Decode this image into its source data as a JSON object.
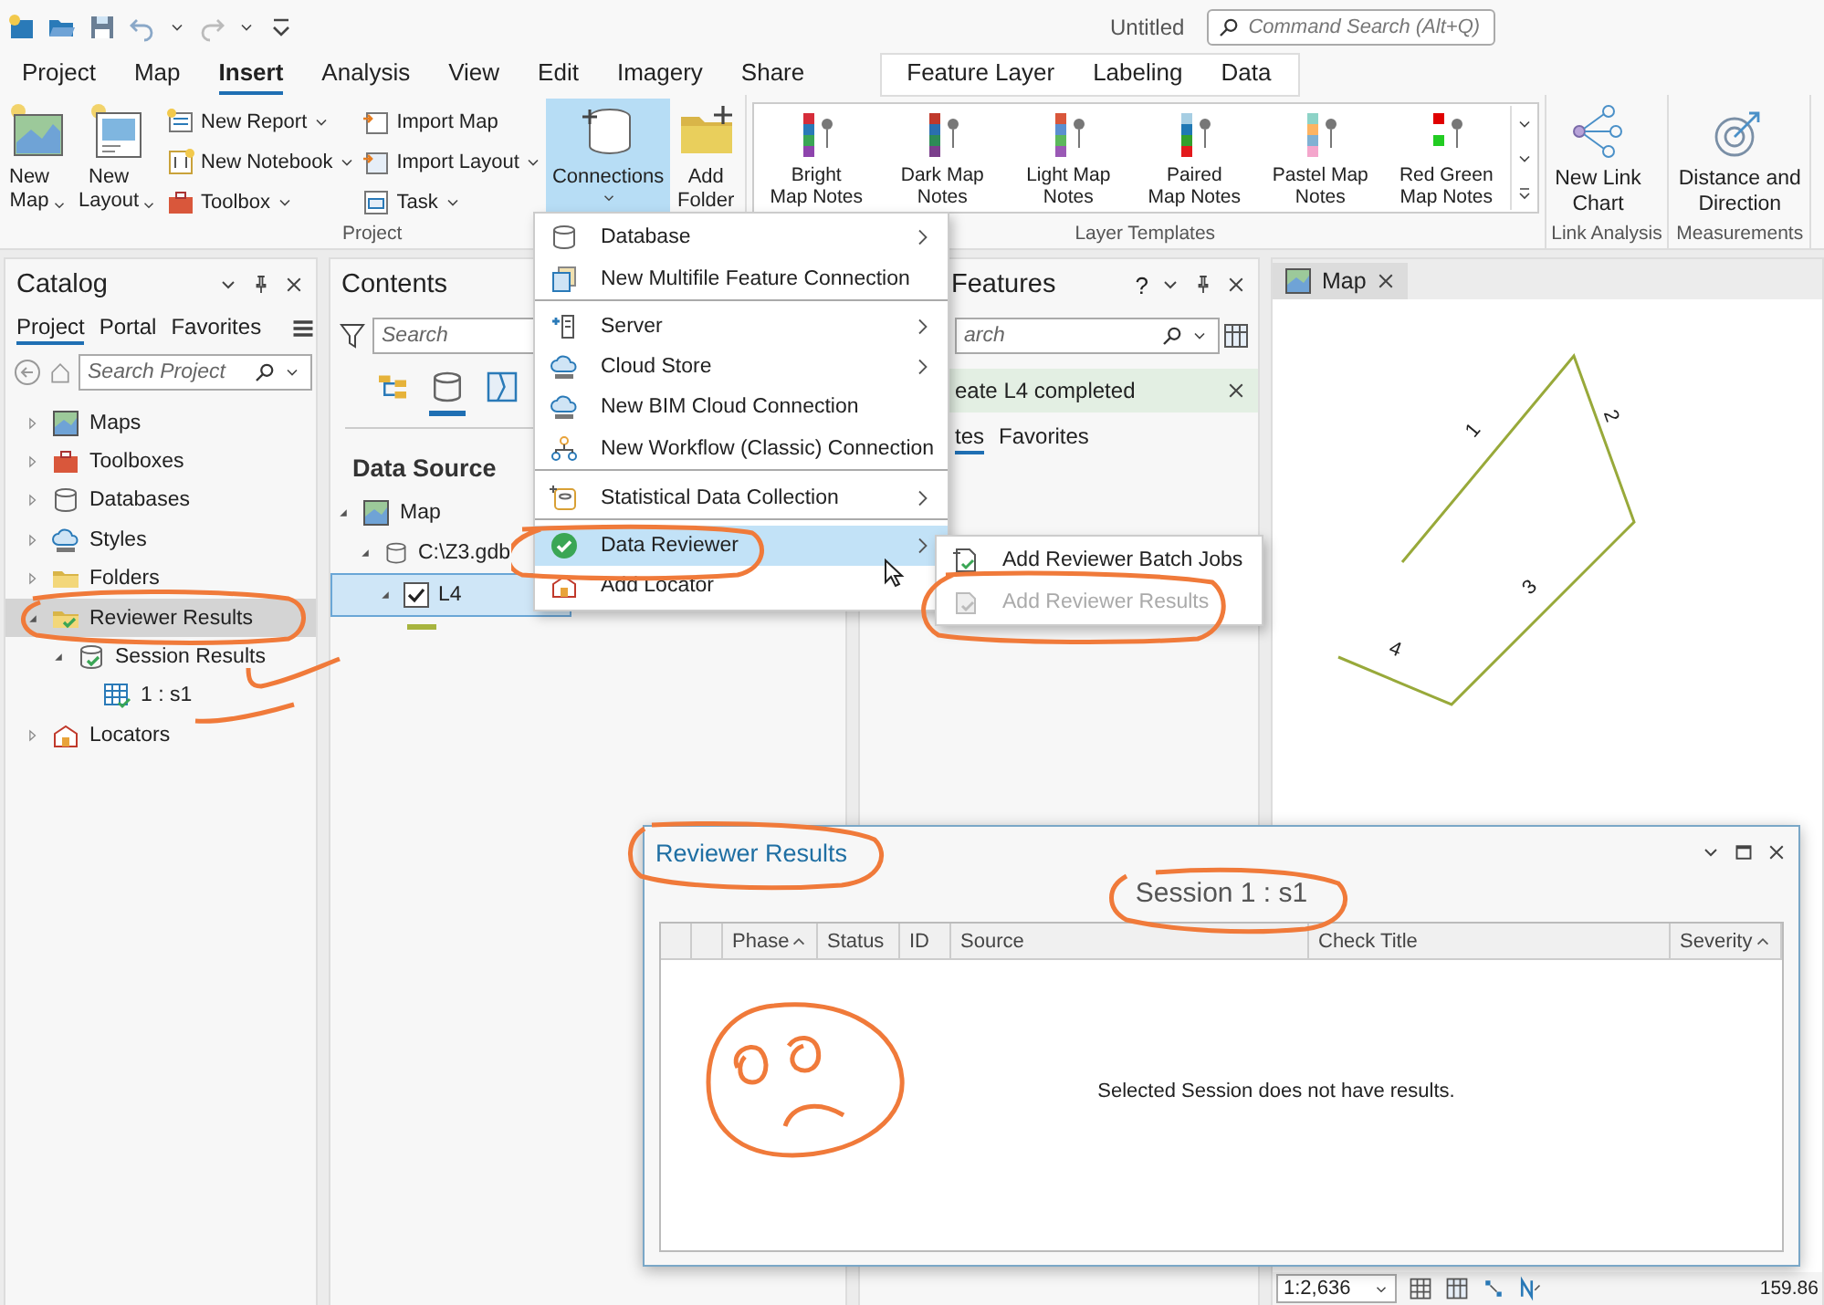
{
  "quick_access": {
    "title": "Untitled",
    "search": {
      "placeholder": "Command Search (Alt+Q)"
    }
  },
  "tabs": [
    {
      "label": "Project",
      "selected": false
    },
    {
      "label": "Map",
      "selected": false
    },
    {
      "label": "Insert",
      "selected": true
    },
    {
      "label": "Analysis",
      "selected": false
    },
    {
      "label": "View",
      "selected": false
    },
    {
      "label": "Edit",
      "selected": false
    },
    {
      "label": "Imagery",
      "selected": false
    },
    {
      "label": "Share",
      "selected": false
    }
  ],
  "contextual_tabs": [
    {
      "label": "Feature Layer",
      "selected": false
    },
    {
      "label": "Labeling",
      "selected": false
    },
    {
      "label": "Data",
      "selected": false
    }
  ],
  "ribbon": {
    "project": {
      "label": "Project",
      "large": [
        {
          "label": "New\nMap",
          "dropdown": true
        },
        {
          "label": "New\nLayout",
          "dropdown": true
        }
      ],
      "small_columns": [
        [
          {
            "label": "New Report",
            "dropdown": true
          },
          {
            "label": "New Notebook",
            "dropdown": true
          },
          {
            "label": "Toolbox",
            "dropdown": true
          }
        ],
        [
          {
            "label": "Import Map",
            "dropdown": false
          },
          {
            "label": "Import Layout",
            "dropdown": true
          },
          {
            "label": "Task",
            "dropdown": true
          }
        ]
      ],
      "connections": {
        "label": "Connections",
        "active": true
      },
      "add_folder": {
        "label": "Add\nFolder"
      }
    },
    "layer_templates": {
      "label": "Layer Templates",
      "items": [
        "Bright\nMap Notes",
        "Dark Map\nNotes",
        "Light Map\nNotes",
        "Paired\nMap Notes",
        "Pastel Map\nNotes",
        "Red Green\nMap Notes"
      ]
    },
    "link_analysis": {
      "label": "Link Analysis",
      "button": "New Link\nChart"
    },
    "measurements": {
      "label": "Measurements",
      "button": "Distance and\nDirection"
    }
  },
  "catalog": {
    "title": "Catalog",
    "tabs": [
      {
        "label": "Project",
        "selected": true
      },
      {
        "label": "Portal",
        "selected": false
      },
      {
        "label": "Favorites",
        "selected": false
      }
    ],
    "search": {
      "placeholder": "Search Project"
    },
    "tree": [
      {
        "label": "Maps",
        "expanded": false,
        "selected": false
      },
      {
        "label": "Toolboxes",
        "expanded": false,
        "selected": false
      },
      {
        "label": "Databases",
        "expanded": false,
        "selected": false
      },
      {
        "label": "Styles",
        "expanded": false,
        "selected": false
      },
      {
        "label": "Folders",
        "expanded": false,
        "selected": false
      },
      {
        "label": "Reviewer Results",
        "expanded": true,
        "selected": true,
        "children": [
          {
            "label": "Session Results",
            "expanded": true,
            "children": [
              {
                "label": "1 : s1"
              }
            ]
          }
        ]
      },
      {
        "label": "Locators",
        "expanded": false,
        "selected": false
      }
    ]
  },
  "contents": {
    "title": "Contents",
    "search": {
      "placeholder": "Search"
    },
    "views": [
      {
        "selected": false
      },
      {
        "selected": true
      },
      {
        "selected": false
      }
    ],
    "heading": "Data Source",
    "tree": {
      "label": "Map",
      "expanded": true,
      "children": [
        {
          "label": "C:\\Z3.gdb",
          "expanded": true,
          "children": [
            {
              "label": "L4",
              "expanded": true,
              "checked": true,
              "selected": true
            }
          ]
        }
      ]
    }
  },
  "features": {
    "title": "Features",
    "help": "?",
    "search": {
      "placeholder": "arch"
    },
    "notice": "eate L4 completed",
    "tabs": [
      {
        "label": "tes",
        "selected": true
      },
      {
        "label": "Favorites",
        "selected": false
      }
    ]
  },
  "map": {
    "tab": "Map",
    "labels": [
      "1",
      "2",
      "3",
      "4"
    ],
    "scale": "1:2,636",
    "coordinate": "159.86"
  },
  "connections_menu": {
    "items": [
      {
        "label": "Database",
        "submenu": true,
        "highlighted": false,
        "divider_after": false
      },
      {
        "label": "New Multifile Feature Connection",
        "submenu": false,
        "highlighted": false,
        "divider_after": true
      },
      {
        "label": "Server",
        "submenu": true,
        "highlighted": false,
        "divider_after": false
      },
      {
        "label": "Cloud Store",
        "submenu": true,
        "highlighted": false,
        "divider_after": false
      },
      {
        "label": "New BIM Cloud Connection",
        "submenu": false,
        "highlighted": false,
        "divider_after": false
      },
      {
        "label": "New Workflow (Classic) Connection",
        "submenu": false,
        "highlighted": false,
        "divider_after": true
      },
      {
        "label": "Statistical Data Collection",
        "submenu": true,
        "highlighted": false,
        "divider_after": true
      },
      {
        "label": "Data Reviewer",
        "submenu": true,
        "highlighted": true,
        "divider_after": false
      },
      {
        "label": "Add Locator",
        "submenu": false,
        "highlighted": false,
        "divider_after": false
      }
    ],
    "submenu": [
      {
        "label": "Add Reviewer Batch Jobs",
        "disabled": false
      },
      {
        "label": "Add Reviewer Results",
        "disabled": true
      }
    ]
  },
  "dialog": {
    "title": "Reviewer Results",
    "session": "Session 1 : s1",
    "columns": [
      {
        "label": "Phase",
        "sorted": true
      },
      {
        "label": "Status",
        "sorted": false
      },
      {
        "label": "ID",
        "sorted": false
      },
      {
        "label": "Source",
        "sorted": false
      },
      {
        "label": "Check Title",
        "sorted": false
      },
      {
        "label": "Severity",
        "sorted": true
      }
    ],
    "empty_message": "Selected Session does not have results."
  }
}
